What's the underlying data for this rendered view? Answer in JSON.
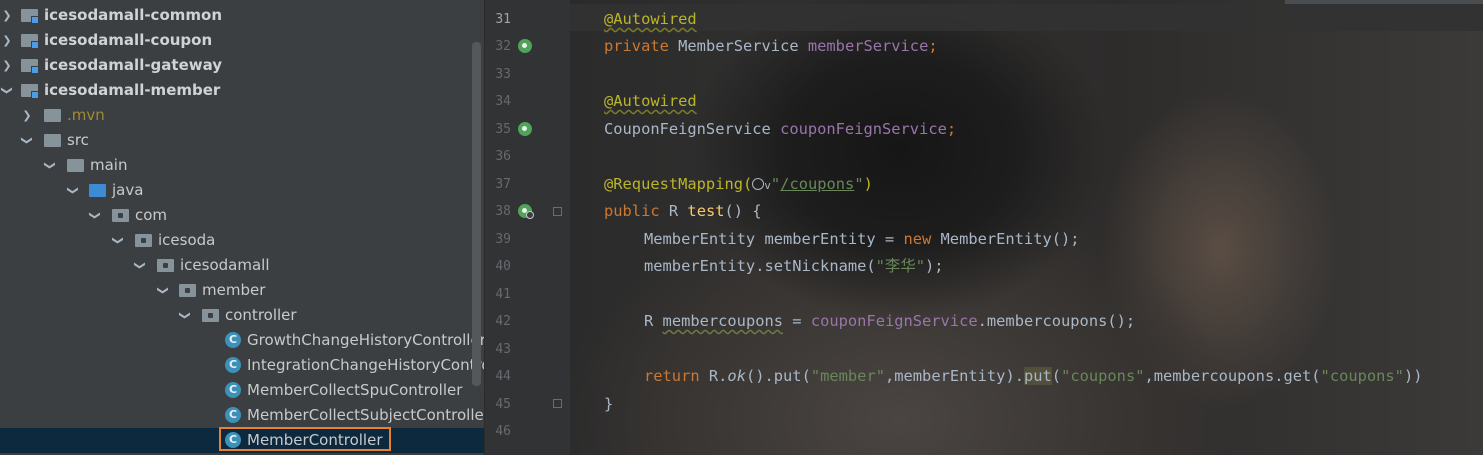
{
  "project_tree": {
    "items": [
      {
        "label": "icesodamall-common",
        "expanded": false,
        "icon": "module-folder-icon"
      },
      {
        "label": "icesodamall-coupon",
        "expanded": false,
        "icon": "module-folder-icon"
      },
      {
        "label": "icesodamall-gateway",
        "expanded": false,
        "icon": "module-folder-icon"
      },
      {
        "label": "icesodamall-member",
        "expanded": true,
        "icon": "module-folder-icon"
      },
      {
        "label": ".mvn",
        "expanded": false,
        "icon": "folder-icon"
      },
      {
        "label": "src",
        "expanded": true,
        "icon": "folder-icon"
      },
      {
        "label": "main",
        "expanded": true,
        "icon": "folder-icon"
      },
      {
        "label": "java",
        "expanded": true,
        "icon": "source-folder-icon"
      },
      {
        "label": "com",
        "expanded": true,
        "icon": "package-icon"
      },
      {
        "label": "icesoda",
        "expanded": true,
        "icon": "package-icon"
      },
      {
        "label": "icesodamall",
        "expanded": true,
        "icon": "package-icon"
      },
      {
        "label": "member",
        "expanded": true,
        "icon": "package-icon"
      },
      {
        "label": "controller",
        "expanded": true,
        "icon": "package-icon"
      },
      {
        "label": "GrowthChangeHistoryController",
        "icon": "class-icon"
      },
      {
        "label": "IntegrationChangeHistoryContro",
        "icon": "class-icon"
      },
      {
        "label": "MemberCollectSpuController",
        "icon": "class-icon"
      },
      {
        "label": "MemberCollectSubjectControlle",
        "icon": "class-icon"
      },
      {
        "label": "MemberController",
        "icon": "class-icon",
        "selected": true
      }
    ],
    "class_icon_letter": "C",
    "selected_highlight_color": "#e8802c"
  },
  "editor": {
    "line_numbers": [
      "31",
      "32",
      "33",
      "34",
      "35",
      "36",
      "37",
      "38",
      "39",
      "40",
      "41",
      "42",
      "43",
      "44",
      "45",
      "46"
    ],
    "code": {
      "l31_annotation": "@Autowired",
      "l32_kw": "private",
      "l32_type": " MemberService ",
      "l32_field": "memberService",
      "l32_end": ";",
      "l34_annotation": "@Autowired",
      "l35_type": "CouponFeignService ",
      "l35_field": "couponFeignService",
      "l35_end": ";",
      "l37_annotation": "@RequestMapping(",
      "l37_hint": "v",
      "l37_quote_open": "\"",
      "l37_url": "/coupons",
      "l37_quote_close": "\"",
      "l37_close": ")",
      "l38_kw": "public",
      "l38_type": " R ",
      "l38_method": "test",
      "l38_rest": "() {",
      "l39_type": "MemberEntity memberEntity = ",
      "l39_kw": "new",
      "l39_rest": " MemberEntity();",
      "l40_call": "memberEntity.setNickname(",
      "l40_str": "\"李华\"",
      "l40_end": ");",
      "l42_type": "R ",
      "l42_var": "membercoupons",
      "l42_eq": " = ",
      "l42_field": "couponFeignService",
      "l42_rest": ".membercoupons();",
      "l44_kw": "return",
      "l44_r": " R.",
      "l44_ok": "ok",
      "l44_put1": "().put(",
      "l44_str1": "\"member\"",
      "l44_mid": ",memberEntity).",
      "l44_put2": "put",
      "l44_open": "(",
      "l44_str2": "\"coupons\"",
      "l44_mid2": ",membercoupons.get(",
      "l44_str3": "\"coupons\"",
      "l44_end": "))",
      "l45_brace": "}"
    },
    "colors": {
      "keyword": "#cc7832",
      "annotation": "#bbb529",
      "field": "#9876aa",
      "string": "#6a8759",
      "method_decl": "#ffc66d",
      "plain": "#a9b7c6"
    }
  }
}
